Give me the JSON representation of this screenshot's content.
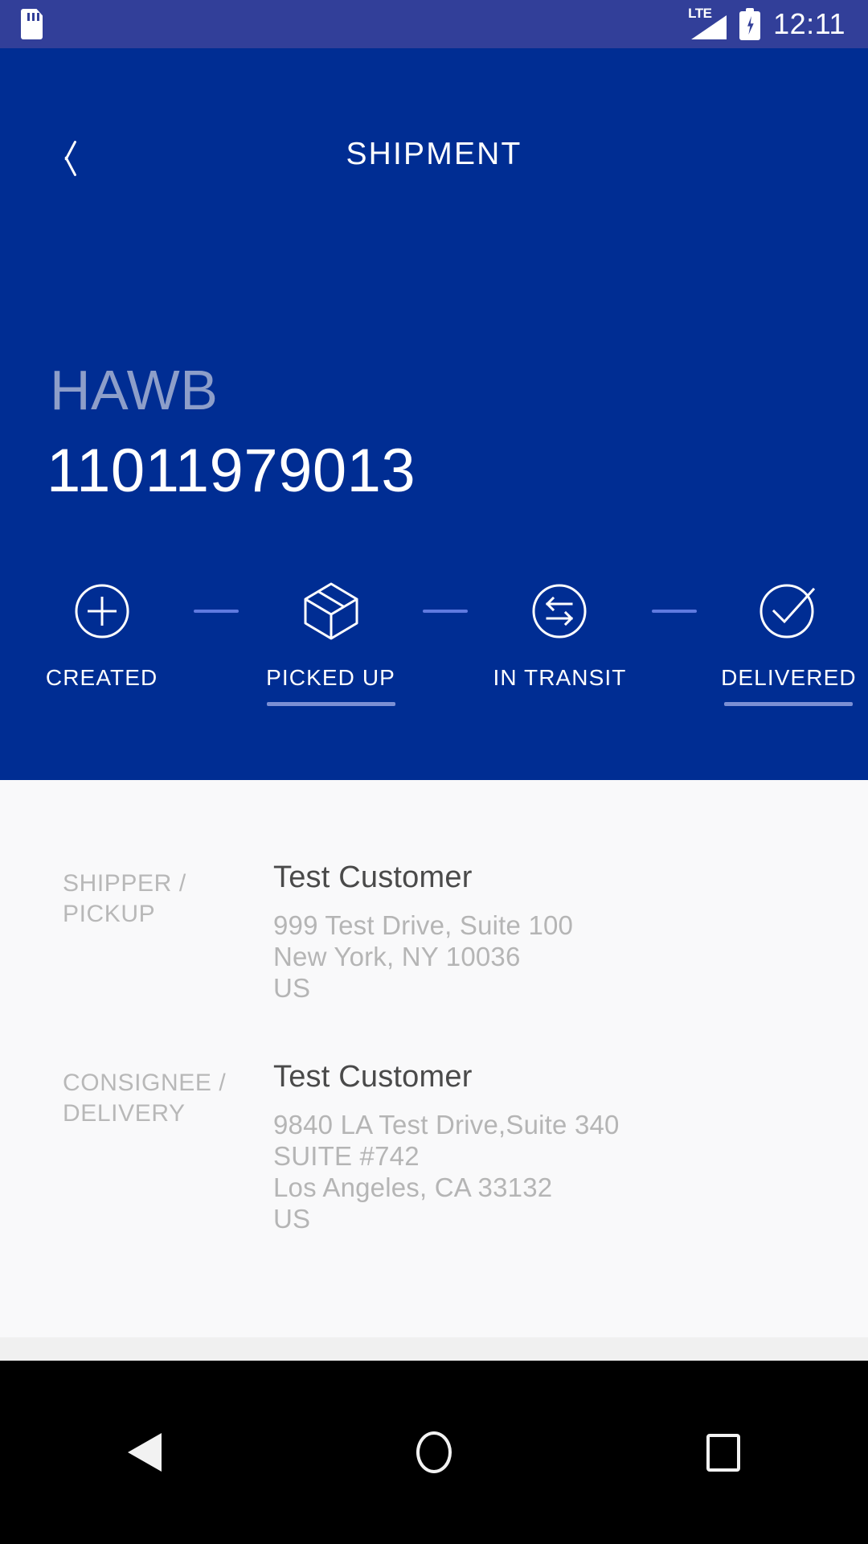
{
  "statusbar": {
    "sd_icon": "sd-card-icon",
    "network_label": "LTE",
    "signal_icon": "signal-bars-icon",
    "battery_icon": "battery-charging-icon",
    "time": "12:11"
  },
  "appbar": {
    "back_icon": "back-chevron-icon",
    "title": "SHIPMENT"
  },
  "shipment": {
    "label": "HAWB",
    "number": "11011979013"
  },
  "tracker": {
    "steps": [
      {
        "key": "created",
        "label": "CREATED",
        "icon": "plus-circle-icon",
        "active": false
      },
      {
        "key": "picked_up",
        "label": "PICKED UP",
        "icon": "package-box-icon",
        "active": true
      },
      {
        "key": "in_transit",
        "label": "IN TRANSIT",
        "icon": "transfer-arrows-icon",
        "active": false
      },
      {
        "key": "delivered",
        "label": "DELIVERED",
        "icon": "check-circle-icon",
        "active": true
      }
    ],
    "connector_count": 3
  },
  "details": [
    {
      "key": "SHIPPER /\nPICKUP",
      "name": "Test Customer",
      "address": "999 Test Drive, Suite 100\nNew York, NY 10036\nUS"
    },
    {
      "key": "CONSIGNEE /\nDELIVERY",
      "name": "Test Customer",
      "address": "9840 LA Test Drive,Suite 340\nSUITE #742\nLos Angeles, CA 33132\nUS"
    }
  ],
  "navbar": {
    "back": "nav-back-icon",
    "home": "nav-home-icon",
    "recents": "nav-recents-icon"
  },
  "colors": {
    "status_bar": "#323f99",
    "hero": "#002d93",
    "accent_underline": "#7b8fd4",
    "connector": "#5f7ae0",
    "hawb_label": "#8d9ec9",
    "page_bg": "#f9f9fa"
  }
}
